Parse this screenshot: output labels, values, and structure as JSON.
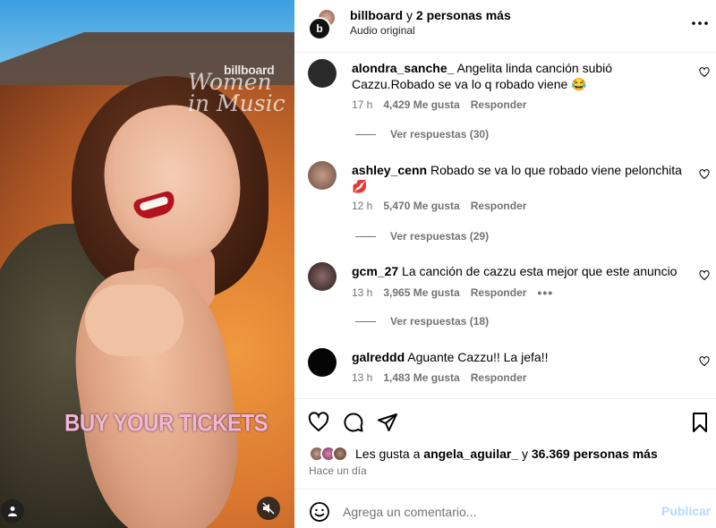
{
  "media": {
    "watermark_brand": "billboard",
    "watermark_title": "Women in Music",
    "overlay_text": "BUY YOUR TICKETS",
    "icons": [
      "user-icon",
      "mute-icon"
    ]
  },
  "header": {
    "account": "billboard",
    "connector": "y",
    "others": "2 personas más",
    "subtitle": "Audio original",
    "avatar_letter": "b"
  },
  "comments": [
    {
      "user": "alondra_sanche_",
      "text": "Angelita linda canción subió Cazzu.Robado se va lo q robado viene 😂",
      "time": "17 h",
      "likes": "4,429 Me gusta",
      "reply": "Responder",
      "view_replies": "Ver respuestas (30)",
      "avatar_color": "#2a2a2a"
    },
    {
      "user": "ashley_cenn",
      "text": "Robado se va lo que robado viene pelonchita 💋",
      "time": "12 h",
      "likes": "5,470 Me gusta",
      "reply": "Responder",
      "view_replies": "Ver respuestas (29)",
      "avatar_color": "#8d6e63"
    },
    {
      "user": "gcm_27",
      "text": "La canción de cazzu esta mejor que este anuncio",
      "time": "13 h",
      "likes": "3,965 Me gusta",
      "reply": "Responder",
      "more": "•••",
      "view_replies": "Ver respuestas (18)",
      "avatar_color": "#3b2b2b"
    },
    {
      "user": "galreddd",
      "text": "Aguante Cazzu!! La jefa!!",
      "time": "13 h",
      "likes": "1,483 Me gusta",
      "reply": "Responder",
      "avatar_color": "#050505"
    }
  ],
  "likes_summary": {
    "prefix": "Les gusta a",
    "user": "angela_aguilar_",
    "connector": "y",
    "others": "36.369 personas más"
  },
  "time_ago": "Hace un día",
  "compose": {
    "placeholder": "Agrega un comentario...",
    "publish": "Publicar"
  },
  "colors": {
    "muted_text": "#737373",
    "publish_disabled": "#b3dbff",
    "divider": "#efefef"
  }
}
